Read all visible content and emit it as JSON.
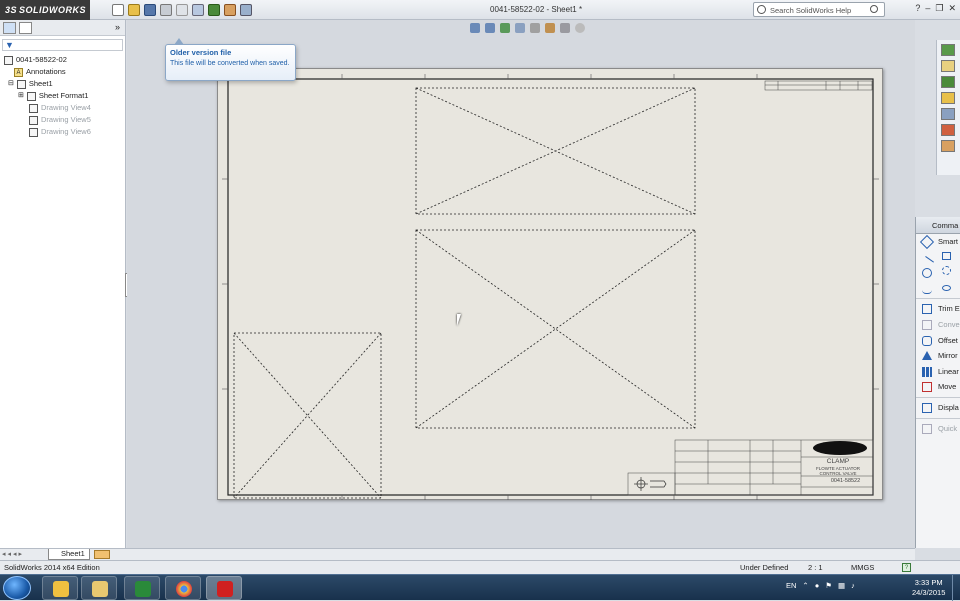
{
  "app": {
    "brand": "SOLIDWORKS",
    "brand_prefix": "3S",
    "document_title": "0041-58522-02 - Sheet1 *",
    "search_placeholder": "Search SolidWorks Help"
  },
  "tooltip": {
    "title": "Older version file",
    "body": "This file will be converted when saved."
  },
  "feature_tree": {
    "root": "0041-58522-02",
    "items": [
      {
        "label": "Annotations",
        "indent": 1,
        "dim": false
      },
      {
        "label": "Sheet1",
        "indent": 1,
        "dim": false
      },
      {
        "label": "Sheet Format1",
        "indent": 2,
        "dim": false
      },
      {
        "label": "Drawing View4",
        "indent": 2,
        "dim": true
      },
      {
        "label": "Drawing View5",
        "indent": 2,
        "dim": true
      },
      {
        "label": "Drawing View6",
        "indent": 2,
        "dim": true
      }
    ]
  },
  "sheet_tab": "Sheet1",
  "command_panel": {
    "title": "Comma",
    "items": [
      {
        "label": "Smart",
        "dim": false
      },
      {
        "label": "Trim E",
        "dim": false
      },
      {
        "label": "Conve",
        "dim": true
      },
      {
        "label": "Offset",
        "dim": false
      },
      {
        "label": "Mirror",
        "dim": false
      },
      {
        "label": "Linear",
        "dim": false
      },
      {
        "label": "Move",
        "dim": false
      },
      {
        "label": "Displa",
        "dim": false
      },
      {
        "label": "Quick",
        "dim": true
      }
    ]
  },
  "title_block": {
    "part_name": "CLAMP",
    "desc1": "FLOWTE ACTUATOR",
    "desc2": "CONTROL VALVE",
    "drawing_number": "0041-58522"
  },
  "status_bar": {
    "edition": "SolidWorks 2014 x64 Edition",
    "state": "Under Defined",
    "scale": "2 : 1",
    "units": "MMGS",
    "help": "?"
  },
  "taskbar": {
    "language": "EN",
    "time": "3:33 PM",
    "date": "24/3/2015"
  },
  "colors": {
    "sheet": "#e8e6df",
    "tooltip_text": "#1f5fa8",
    "taskbar": "#18314c"
  }
}
